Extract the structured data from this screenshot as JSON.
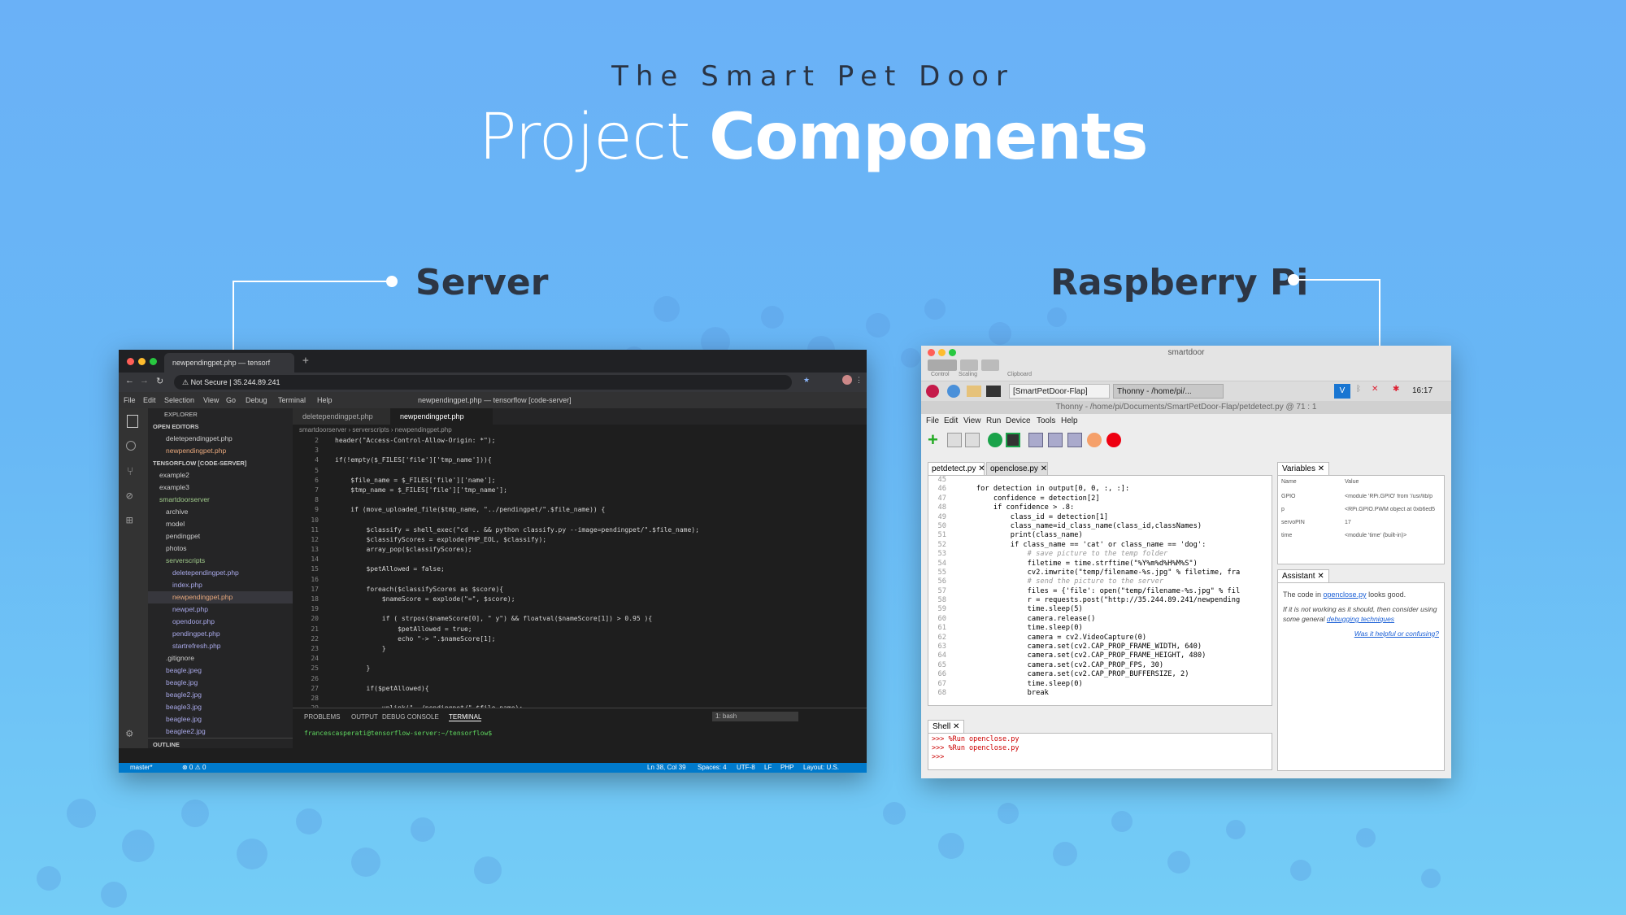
{
  "header": {
    "subtitle": "The Smart Pet Door",
    "title_light": "Project",
    "title_bold": "Components"
  },
  "labels": {
    "server": "Server",
    "pi": "Raspberry Pi"
  },
  "colors": {
    "bg_top": "#6ab1f7",
    "bg_bottom": "#74cdf6",
    "heading": "#2d3644"
  },
  "server": {
    "tab_title": "newpendingpet.php — tensorf",
    "url_security": "Not Secure",
    "url": "35.244.89.241",
    "menu": [
      "File",
      "Edit",
      "Selection",
      "View",
      "Go",
      "Debug",
      "Terminal",
      "Help"
    ],
    "window_title": "newpendingpet.php — tensorflow [code-server]",
    "explorer": [
      "EXPLORER",
      "OPEN EDITORS",
      "deletependingpet.php",
      "newpendingpet.php",
      "TENSORFLOW [CODE-SERVER]",
      "example2",
      "example3",
      "smartdoorserver",
      "archive",
      "model",
      "pendingpet",
      "photos",
      "serverscripts",
      "deletependingpet.php",
      "index.php",
      "newpendingpet.php",
      "newpet.php",
      "opendoor.php",
      "pendingpet.php",
      "startrefresh.php",
      ".gitignore",
      "beagle.jpeg",
      "beagle.jpg",
      "beagle2.jpg",
      "beagle3.jpg",
      "beaglee.jpg",
      "beaglee2.jpg",
      "OUTLINE"
    ],
    "editor_tabs": [
      "deletependingpet.php",
      "newpendingpet.php"
    ],
    "breadcrumb": "smartdoorserver › serverscripts › newpendingpet.php",
    "code": [
      {
        "n": "2",
        "t": "header(\"Access-Control-Allow-Origin: *\");"
      },
      {
        "n": "3",
        "t": ""
      },
      {
        "n": "4",
        "t": "if(!empty($_FILES['file']['tmp_name'])){"
      },
      {
        "n": "5",
        "t": ""
      },
      {
        "n": "6",
        "t": "    $file_name = $_FILES['file']['name'];"
      },
      {
        "n": "7",
        "t": "    $tmp_name = $_FILES['file']['tmp_name'];"
      },
      {
        "n": "8",
        "t": ""
      },
      {
        "n": "9",
        "t": "    if (move_uploaded_file($tmp_name, \"../pendingpet/\".$file_name)) {"
      },
      {
        "n": "10",
        "t": ""
      },
      {
        "n": "11",
        "t": "        $classify = shell_exec(\"cd .. && python classify.py --image=pendingpet/\".$file_name);"
      },
      {
        "n": "12",
        "t": "        $classifyScores = explode(PHP_EOL, $classify);"
      },
      {
        "n": "13",
        "t": "        array_pop($classifyScores);"
      },
      {
        "n": "14",
        "t": ""
      },
      {
        "n": "15",
        "t": "        $petAllowed = false;"
      },
      {
        "n": "16",
        "t": ""
      },
      {
        "n": "17",
        "t": "        foreach($classifyScores as $score){"
      },
      {
        "n": "18",
        "t": "            $nameScore = explode(\"=\", $score);"
      },
      {
        "n": "19",
        "t": ""
      },
      {
        "n": "20",
        "t": "            if ( strpos($nameScore[0], \" y\") && floatval($nameScore[1]) > 0.95 ){"
      },
      {
        "n": "21",
        "t": "                $petAllowed = true;"
      },
      {
        "n": "22",
        "t": "                echo \"-> \".$nameScore[1];"
      },
      {
        "n": "23",
        "t": "            }"
      },
      {
        "n": "24",
        "t": ""
      },
      {
        "n": "25",
        "t": "        }"
      },
      {
        "n": "26",
        "t": ""
      },
      {
        "n": "27",
        "t": "        if($petAllowed){"
      },
      {
        "n": "28",
        "t": ""
      },
      {
        "n": "29",
        "t": "            unlink(\"../pendingpet/\".$file_name);"
      }
    ],
    "terminal_tabs": [
      "PROBLEMS",
      "OUTPUT",
      "DEBUG CONSOLE",
      "TERMINAL"
    ],
    "terminal_select": "1: bash",
    "prompt": "francescasperati@tensorflow-server:~/tensorflow$",
    "status": {
      "branch": "master*",
      "problems": "⊗ 0 ⚠ 0",
      "cursor": "Ln 38, Col 39",
      "spaces": "Spaces: 4",
      "encoding": "UTF-8",
      "eol": "LF",
      "lang": "PHP",
      "layout": "Layout: U.S."
    }
  },
  "pi": {
    "vnc_title": "smartdoor",
    "vnc_tools": [
      "Control",
      "Scaling",
      "Clipboard"
    ],
    "taskbar": [
      "[SmartPetDoor-Flap]",
      "Thonny  -  /home/pi/..."
    ],
    "clock": "16:17",
    "title": "Thonny  -  /home/pi/Documents/SmartPetDoor-Flap/petdetect.py  @  71 : 1",
    "menu": [
      "File",
      "Edit",
      "View",
      "Run",
      "Device",
      "Tools",
      "Help"
    ],
    "tabs": [
      "petdetect.py",
      "openclose.py"
    ],
    "code": [
      {
        "n": "45",
        "t": ""
      },
      {
        "n": "46",
        "t": "    for detection in output[0, 0, :, :]:"
      },
      {
        "n": "47",
        "t": "        confidence = detection[2]"
      },
      {
        "n": "48",
        "t": "        if confidence > .8:"
      },
      {
        "n": "49",
        "t": "            class_id = detection[1]"
      },
      {
        "n": "50",
        "t": "            class_name=id_class_name(class_id,classNames)"
      },
      {
        "n": "51",
        "t": "            print(class_name)"
      },
      {
        "n": "52",
        "t": "            if class_name == 'cat' or class_name == 'dog':"
      },
      {
        "n": "53",
        "t": "                # save picture to the temp folder"
      },
      {
        "n": "54",
        "t": "                filetime = time.strftime(\"%Y%m%d%H%M%S\")"
      },
      {
        "n": "55",
        "t": "                cv2.imwrite(\"temp/filename-%s.jpg\" % filetime, fra"
      },
      {
        "n": "56",
        "t": "                # send the picture to the server"
      },
      {
        "n": "57",
        "t": "                files = {'file': open(\"temp/filename-%s.jpg\" % fil"
      },
      {
        "n": "58",
        "t": "                r = requests.post(\"http://35.244.89.241/newpending"
      },
      {
        "n": "59",
        "t": "                time.sleep(5)"
      },
      {
        "n": "60",
        "t": "                camera.release()"
      },
      {
        "n": "61",
        "t": "                time.sleep(0)"
      },
      {
        "n": "62",
        "t": "                camera = cv2.VideoCapture(0)"
      },
      {
        "n": "63",
        "t": "                camera.set(cv2.CAP_PROP_FRAME_WIDTH, 640)"
      },
      {
        "n": "64",
        "t": "                camera.set(cv2.CAP_PROP_FRAME_HEIGHT, 480)"
      },
      {
        "n": "65",
        "t": "                camera.set(cv2.CAP_PROP_FPS, 30)"
      },
      {
        "n": "66",
        "t": "                camera.set(cv2.CAP_PROP_BUFFERSIZE, 2)"
      },
      {
        "n": "67",
        "t": "                time.sleep(0)"
      },
      {
        "n": "68",
        "t": "                break"
      }
    ],
    "shell_tab": "Shell",
    "shell": [
      ">>> %Run openclose.py",
      ">>> %Run openclose.py",
      ">>>"
    ],
    "variables_tab": "Variables",
    "var_headers": [
      "Name",
      "Value"
    ],
    "vars": [
      {
        "name": "GPIO",
        "value": "<module 'RPi.GPIO' from '/usr/lib/p"
      },
      {
        "name": "p",
        "value": "<RPi.GPIO.PWM object at 0xb6ed5"
      },
      {
        "name": "servoPIN",
        "value": "17"
      },
      {
        "name": "time",
        "value": "<module 'time' (built-in)>"
      }
    ],
    "assistant_tab": "Assistant",
    "assist_pre": "The code in ",
    "assist_link": "openclose.py",
    "assist_post": " looks good.",
    "assist_note_pre": "If it is not working as it should, then consider using some general ",
    "assist_note_link": "debugging techniques",
    "assist_question": "Was it helpful or confusing?"
  }
}
